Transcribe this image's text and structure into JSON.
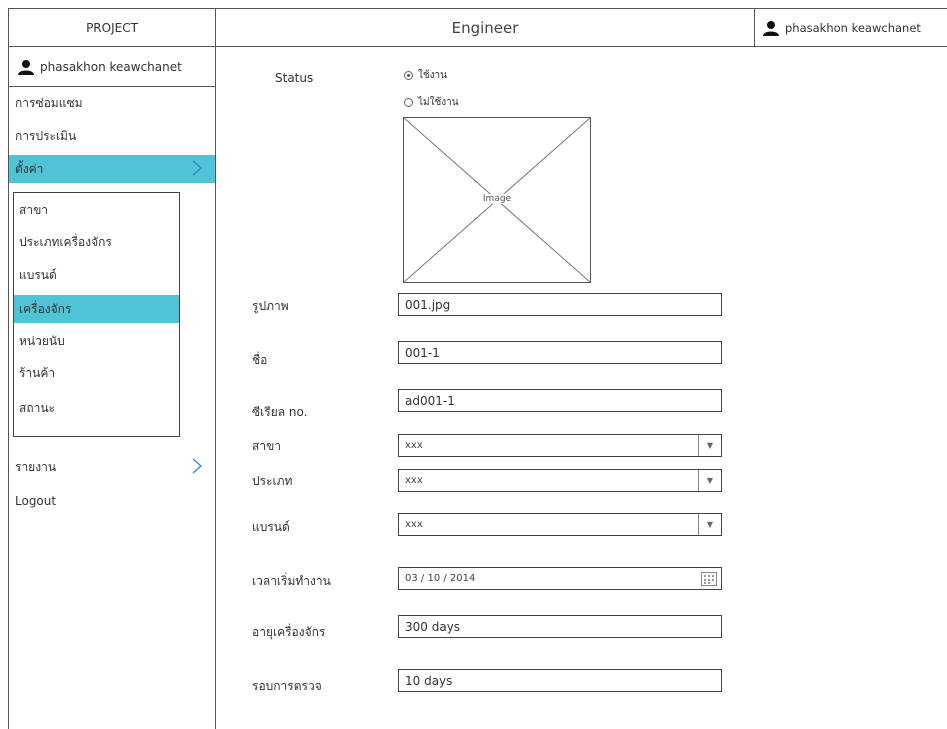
{
  "header": {
    "project": "PROJECT",
    "title": "Engineer",
    "user": "phasakhon keawchanet"
  },
  "sidebar": {
    "user": "phasakhon keawchanet",
    "items": [
      {
        "label": "การซ่อมแซม"
      },
      {
        "label": "การประเมิน"
      },
      {
        "label": "ตั้งค่า"
      },
      {
        "label": "รายงาน"
      },
      {
        "label": "Logout"
      }
    ],
    "submenu": [
      {
        "label": "สาขา"
      },
      {
        "label": "ประเภทเครื่องจักร"
      },
      {
        "label": "แบรนด์"
      },
      {
        "label": "เครื่องจักร"
      },
      {
        "label": "หน่วยนับ"
      },
      {
        "label": "ร้านค้า"
      },
      {
        "label": "สถานะ"
      }
    ]
  },
  "form": {
    "status": {
      "label": "Status",
      "options": [
        "ใช้งาน",
        "ไม่ใช้งาน"
      ],
      "selected": "ใช้งาน"
    },
    "image_placeholder": "Image",
    "image": {
      "label": "รูปภาพ",
      "value": "001.jpg"
    },
    "name": {
      "label": "ชื่อ",
      "value": "001-1"
    },
    "serial": {
      "label": "ซีเรียล no.",
      "value": "ad001-1"
    },
    "branch": {
      "label": "สาขา",
      "value": "xxx"
    },
    "type": {
      "label": "ประเภท",
      "value": "xxx"
    },
    "brand": {
      "label": "แบรนด์",
      "value": "xxx"
    },
    "start_date": {
      "label": "เวลาเริ่มทำงาน",
      "value": "03 / 10 / 2014"
    },
    "machine_age": {
      "label": "อายุเครื่องจักร",
      "value": "300 days"
    },
    "inspection_cycle": {
      "label": "รอบการตรวจ",
      "value": "10 days"
    }
  },
  "colors": {
    "active": "#4fc4d6",
    "border": "#555555"
  }
}
